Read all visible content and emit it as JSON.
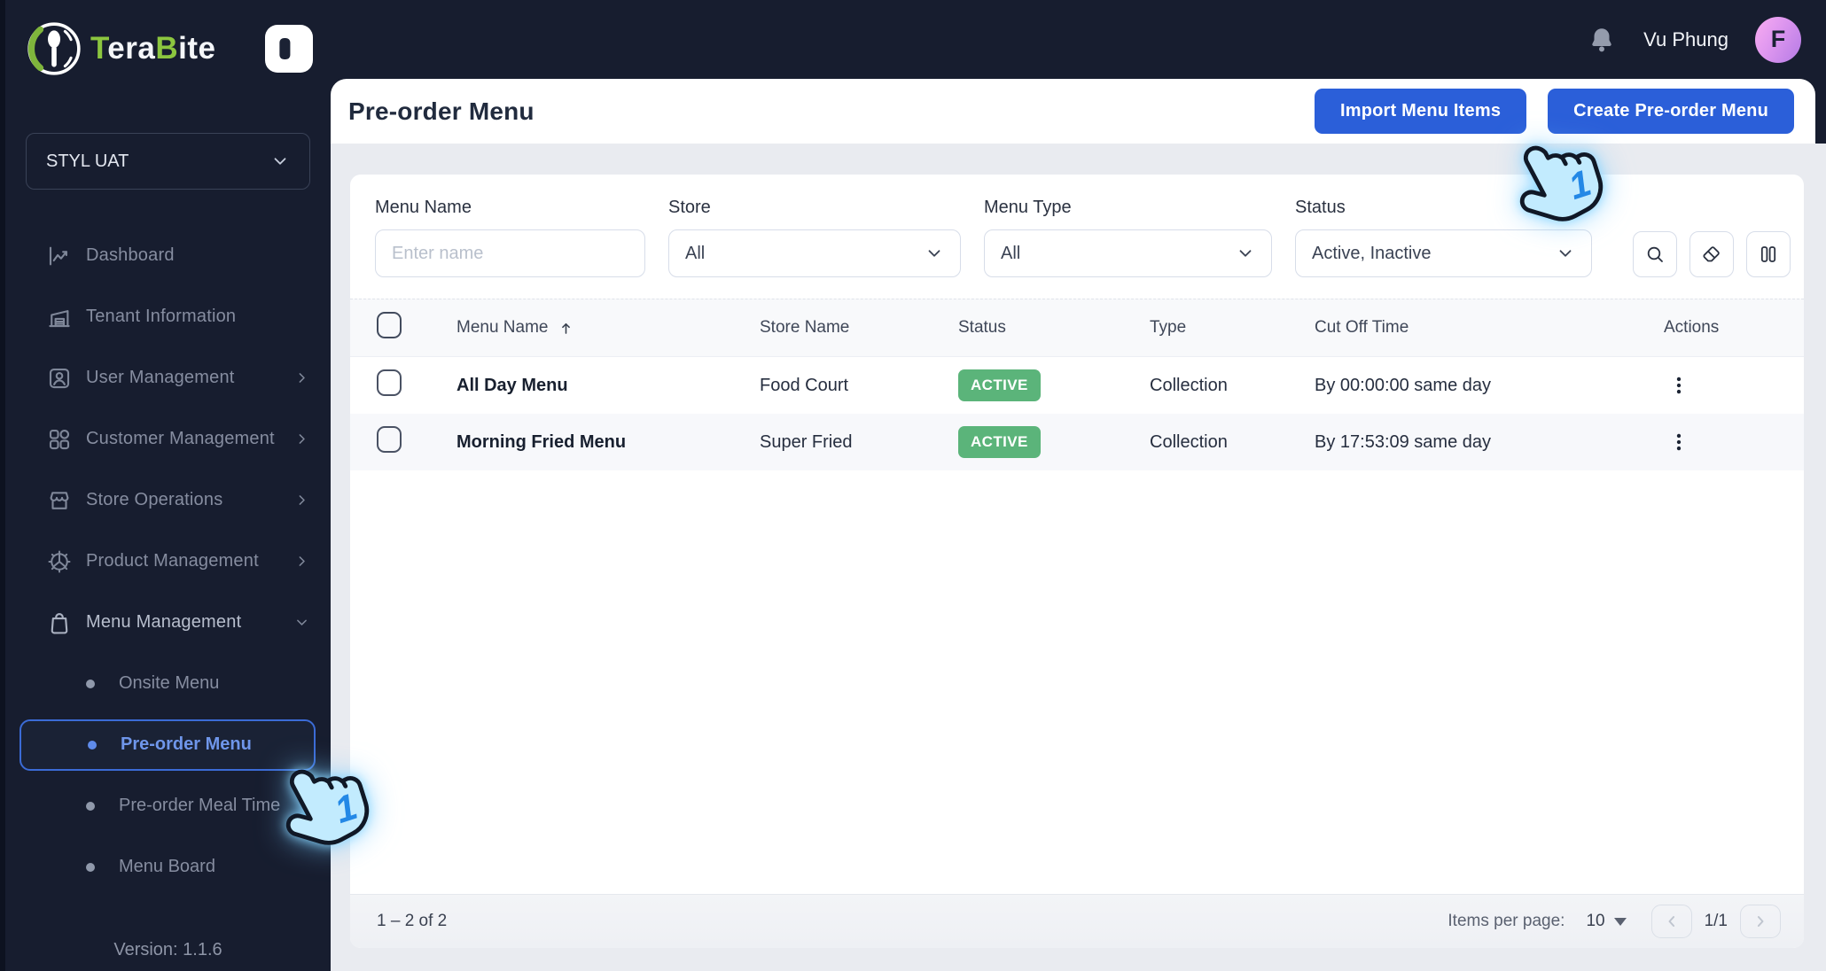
{
  "brand": {
    "t": "T",
    "era": "era",
    "b": "B",
    "ite": "ite"
  },
  "tenant": {
    "value": "STYL UAT"
  },
  "sidebar": {
    "items": [
      {
        "label": "Dashboard"
      },
      {
        "label": "Tenant Information"
      },
      {
        "label": "User Management"
      },
      {
        "label": "Customer Management"
      },
      {
        "label": "Store Operations"
      },
      {
        "label": "Product Management"
      },
      {
        "label": "Menu Management"
      }
    ],
    "submenu": [
      {
        "label": "Onsite Menu"
      },
      {
        "label": "Pre-order Menu"
      },
      {
        "label": "Pre-order Meal Time"
      },
      {
        "label": "Menu Board"
      }
    ],
    "version": "Version: 1.1.6"
  },
  "topbar": {
    "user_name": "Vu Phung",
    "avatar_initial": "F"
  },
  "page": {
    "title": "Pre-order Menu",
    "import_button": "Import Menu Items",
    "create_button": "Create Pre-order Menu"
  },
  "filters": {
    "menu_name": {
      "label": "Menu Name",
      "placeholder": "Enter name"
    },
    "store": {
      "label": "Store",
      "value": "All"
    },
    "menu_type": {
      "label": "Menu Type",
      "value": "All"
    },
    "status": {
      "label": "Status",
      "value": "Active, Inactive"
    }
  },
  "table": {
    "columns": {
      "menu_name": "Menu Name",
      "store_name": "Store Name",
      "status": "Status",
      "type": "Type",
      "cut_off_time": "Cut Off Time",
      "actions": "Actions"
    },
    "rows": [
      {
        "name": "All Day Menu",
        "store": "Food Court",
        "status": "ACTIVE",
        "type": "Collection",
        "cut_off": "By 00:00:00 same day"
      },
      {
        "name": "Morning Fried Menu",
        "store": "Super Fried",
        "status": "ACTIVE",
        "type": "Collection",
        "cut_off": "By 17:53:09 same day"
      }
    ]
  },
  "pagination": {
    "range": "1 – 2 of 2",
    "items_per_page_label": "Items per page:",
    "page_size": "10",
    "page_indicator": "1/1"
  },
  "cursor": {
    "badge": "1"
  },
  "colors": {
    "accent": "#2b5fd9",
    "badge_green": "#5bb47a",
    "sidebar_bg": "#171d2f",
    "selected_blue": "#3b6bd6"
  }
}
